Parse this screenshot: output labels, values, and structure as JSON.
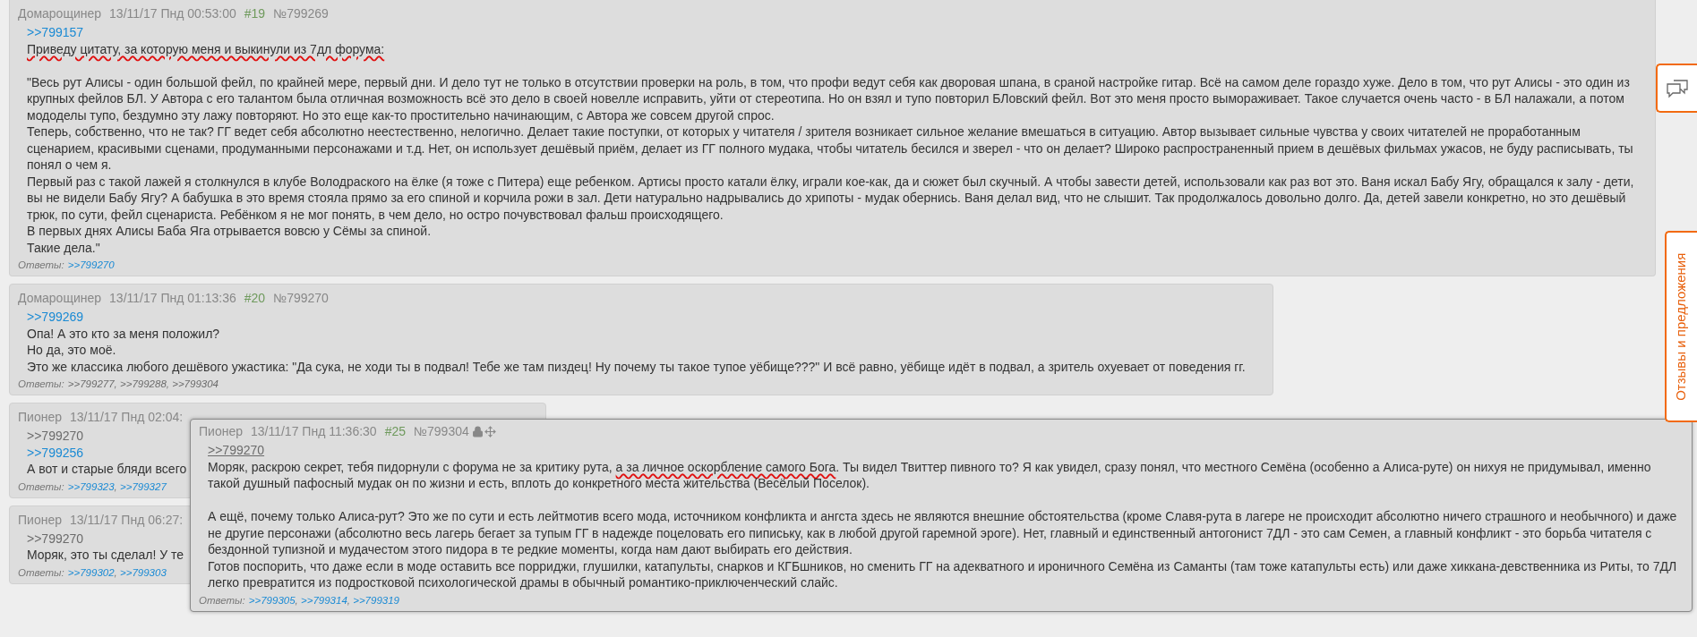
{
  "posts": [
    {
      "author": "Домарощинер",
      "date": "13/11/17 Пнд 00:53:00",
      "number": "#19",
      "post_id": "№799269",
      "body": [
        {
          "kind": "link",
          "text": ">>799157",
          "visited": false,
          "hovered": false
        },
        {
          "kind": "text",
          "parts": [
            {
              "text": "Приведу цитату, за которую меня и выкинули из 7дл форума:",
              "marked": true
            }
          ]
        },
        {
          "kind": "gap"
        },
        {
          "kind": "text",
          "parts": [
            {
              "text": "\"Весь рут Алисы - один большой фейл, по крайней мере, первый дни. И дело тут не только в отсутствии проверки на роль, в том, что профи ведут себя как дворовая шпана, в сраной настройке гитар. Всё на самом деле гораздо хуже. Дело в том, что рут Алисы - это один из крупных фейлов БЛ. У Автора с его талантом была отличная возможность всё это дело в своей новелле исправить, уйти от стереотипа. Но он взял и тупо повторил БЛовский фейл. Вот это меня просто вымораживает. Такое случается очень часто - в БЛ налажали, а потом мододелы тупо, бездумно эту лажу повторяют. Но это еще как-то простительно начинающим, с Автора же совсем другой спрос.",
              "marked": false
            }
          ]
        },
        {
          "kind": "text",
          "parts": [
            {
              "text": "Теперь, собственно, что не так? ГГ ведет себя абсолютно неестественно, нелогично. Делает такие поступки, от которых у читателя / зрителя возникает сильное желание вмешаться в ситуацию. Автор вызывает сильные чувства у своих читателей не проработанным сценарием, красивыми сценами, продуманными персонажами и т.д. Нет, он использует дешёвый приём, делает из ГГ полного мудака, чтобы читатель бесился и зверел - что он делает? Широко распространенный прием в дешёвых фильмах ужасов, не буду расписывать, ты понял о чем я.",
              "marked": false
            }
          ]
        },
        {
          "kind": "text",
          "parts": [
            {
              "text": "Первый раз с такой лажей я столкнулся в клубе Володраского на ёлке (я тоже с Питера) еще ребенком. Артисы просто катали ёлку, играли кое-как, да и сюжет был скучный. А чтобы завести детей, использовали как раз вот это. Ваня искал Бабу Ягу, обращался к залу - дети, вы не видели Бабу Ягу? А бабушка в это время стояла прямо за его спиной и корчила рожи в зал. Дети натурально надрывались до хрипоты - мудак обернись. Ваня делал вид, что не слышит. Так продолжалось довольно долго. Да, детей завели конкретно, но это дешёвый трюк, по сути, фейл сценариста. Ребёнком я не мог понять, в чем дело, но остро почувствовал фальш происходящего.",
              "marked": false
            }
          ]
        },
        {
          "kind": "text",
          "parts": [
            {
              "text": "В первых днях Алисы Баба Яга отрывается вовсю у Сёмы за спиной.",
              "marked": false
            }
          ]
        },
        {
          "kind": "text",
          "parts": [
            {
              "text": "Такие дела.\"",
              "marked": false
            }
          ]
        }
      ],
      "replies_label": "Ответы:",
      "replies": [
        {
          "text": ">>799270",
          "visited": false
        }
      ]
    },
    {
      "author": "Домарощинер",
      "date": "13/11/17 Пнд 01:13:36",
      "number": "#20",
      "post_id": "№799270",
      "body": [
        {
          "kind": "link",
          "text": ">>799269",
          "visited": false,
          "hovered": false
        },
        {
          "kind": "text",
          "parts": [
            {
              "text": "Опа! А это кто за меня положил?",
              "marked": false
            }
          ]
        },
        {
          "kind": "text",
          "parts": [
            {
              "text": "Но да, это моё.",
              "marked": false
            }
          ]
        },
        {
          "kind": "text",
          "parts": [
            {
              "text": "Это же классика любого дешёвого ужастика: \"Да сука, не ходи ты в подвал! Тебе же там пиздец! Ну почему ты такое тупое уёбище???\" И всё равно, уёбище идёт в подвал, а зритель охуевает от поведения гг.",
              "marked": false
            }
          ]
        }
      ],
      "replies_label": "Ответы:",
      "separator": ", ",
      "replies": [
        {
          "text": ">>799277",
          "visited": true
        },
        {
          "text": ">>799288",
          "visited": true
        },
        {
          "text": ">>799304",
          "visited": true
        }
      ]
    },
    {
      "author": "Пионер",
      "date": "13/11/17 Пнд 02:04:",
      "body": [
        {
          "kind": "link",
          "text": ">>799270",
          "visited": true,
          "hovered": false
        },
        {
          "kind": "link",
          "text": ">>799256",
          "visited": false,
          "hovered": false
        },
        {
          "kind": "text",
          "parts": [
            {
              "text": "А вот и старые бляди всего",
              "marked": false
            }
          ]
        }
      ],
      "replies_label": "Ответы:",
      "separator": ", ",
      "replies": [
        {
          "text": ">>799323",
          "visited": false
        },
        {
          "text": ">>799327",
          "visited": false
        }
      ]
    },
    {
      "author": "Пионер",
      "date": "13/11/17 Пнд 06:27:",
      "body": [
        {
          "kind": "link",
          "text": ">>799270",
          "visited": true,
          "hovered": false
        },
        {
          "kind": "text",
          "parts": [
            {
              "text": "Моряк, это ты сделал! У те",
              "marked": false
            }
          ]
        }
      ],
      "replies_label": "Ответы:",
      "separator": ", ",
      "replies": [
        {
          "text": ">>799302",
          "visited": false
        },
        {
          "text": ">>799303",
          "visited": false
        }
      ]
    }
  ],
  "popup_post": {
    "author": "Пионер",
    "date": "13/11/17 Пнд 11:36:30",
    "number": "#25",
    "post_id": "№799304",
    "body": [
      {
        "kind": "link",
        "text": ">>799270",
        "visited": true,
        "hovered": true
      },
      {
        "kind": "text",
        "parts": [
          {
            "text": "Моряк, раскрою секрет, тебя пидорнули с форума не за критику рута, ",
            "marked": false
          },
          {
            "text": "а за личное оскорбление самого Бога",
            "marked": true
          },
          {
            "text": ". Ты видел Твиттер пивного то? Я как увидел, сразу понял, что местного Семёна (особенно а Алиса-руте) он нихуя не придумывал, именно такой душный пафосный мудак он по жизни и есть, вплоть до конкретного места жительства (Весёлый Поселок).",
            "marked": false
          }
        ]
      },
      {
        "kind": "gap"
      },
      {
        "kind": "text",
        "parts": [
          {
            "text": "А ещё, почему только Алиса-рут? Это же по сути и есть лейтмотив всего мода, источником конфликта и ангста здесь не являются внешние обстоятельства (кроме Славя-рута в лагере не происходит абсолютно ничего страшного и необычного) и даже не другие персонажи (абсолютно весь лагерь бегает за тупым ГГ в надежде поцеловать его пипиську, как в любой другой гаремной эроге). Нет, главный и единственный антогонист 7ДЛ - это сам Семен, а главный конфликт - это борьба читателя с бездонной тупизной и мудачестом этого пидора в те редкие моменты, когда нам дают выбирать его действия.",
            "marked": false
          }
        ]
      },
      {
        "kind": "text",
        "parts": [
          {
            "text": "Готов поспорить, что даже если в моде оставить все порриджи, глушилки, катапульты, снарков и КГБшников, но сменить ГГ на адекватного и ироничного Семёна из Саманты (там тоже катапульты есть) или даже хиккана-девственника из Риты, то 7ДЛ легко превратится из подростковой психологической драмы в обычный романтико-приключенческий слайс.",
            "marked": false
          }
        ]
      }
    ],
    "replies_label": "Ответы:",
    "separator": ", ",
    "replies": [
      {
        "text": ">>799305",
        "visited": false
      },
      {
        "text": ">>799314",
        "visited": false
      },
      {
        "text": ">>799319",
        "visited": false
      }
    ]
  },
  "feedback_tab": {
    "label": "Отзывы и предложения"
  }
}
